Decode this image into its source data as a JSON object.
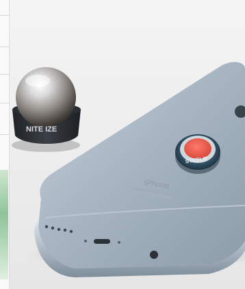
{
  "photo": {
    "subject": "magnetic phone mount and metal disc on back of a smartphone",
    "mount_brand": "NITE IZE",
    "disc_brand": "STEELIE",
    "phone_back_text": "iPhone",
    "colors": {
      "background": "#eeeeee",
      "phone_body": "#a9b7c4",
      "mount_base": "#2d3136",
      "disc_ring": "#2f4e63",
      "disc_center": "#e95a4c"
    }
  }
}
